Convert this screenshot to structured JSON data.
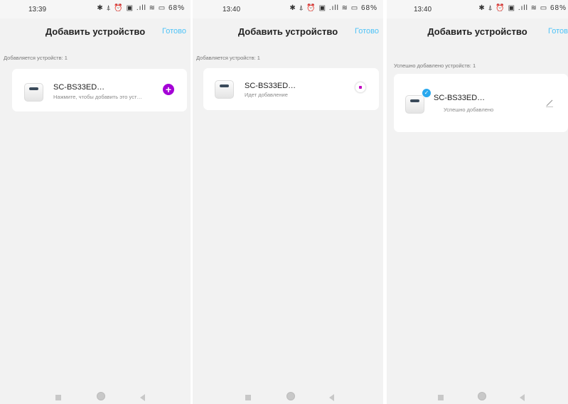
{
  "screens": [
    {
      "status_time": "13:39",
      "status_icons": "✱ ⍋ ⏰ ▣ .ıll ≋ ▭ 68%",
      "header_title": "Добавить устройство",
      "done_label": "Готово",
      "section_label": "Добавляется устройств: 1",
      "device_name": "SC-BS33ED…",
      "device_status": "Нажмите, чтобы добавить это уст…",
      "action": "add-button"
    },
    {
      "status_time": "13:40",
      "status_icons": "✱ ⍋ ⏰ ▣ .ıll ≋ ▭ 68%",
      "header_title": "Добавить устройство",
      "done_label": "Готово",
      "section_label": "Добавляется устройств: 1",
      "device_name": "SC-BS33ED…",
      "device_status": "Идет добавление",
      "action": "progress-indicator"
    },
    {
      "status_time": "13:40",
      "status_icons": "✱ ⍋ ⏰ ▣ .ıll ≋ ▭ 68%",
      "header_title": "Добавить устройство",
      "done_label": "Готово",
      "section_label": "Успешно добавлено устройств: 1",
      "device_name": "SC-BS33ED…",
      "device_status": "Успешно добавлено",
      "action": "edit-icon"
    }
  ],
  "icons": {
    "add": "plus-icon",
    "progress": "loading-icon",
    "success": "check-icon",
    "edit": "pencil-icon",
    "device": "device-icon"
  },
  "colors": {
    "accent_done": "#4fc3f7",
    "add_button": "#a400d6",
    "check_badge": "#29a8ee",
    "background": "#f2f2f2"
  }
}
